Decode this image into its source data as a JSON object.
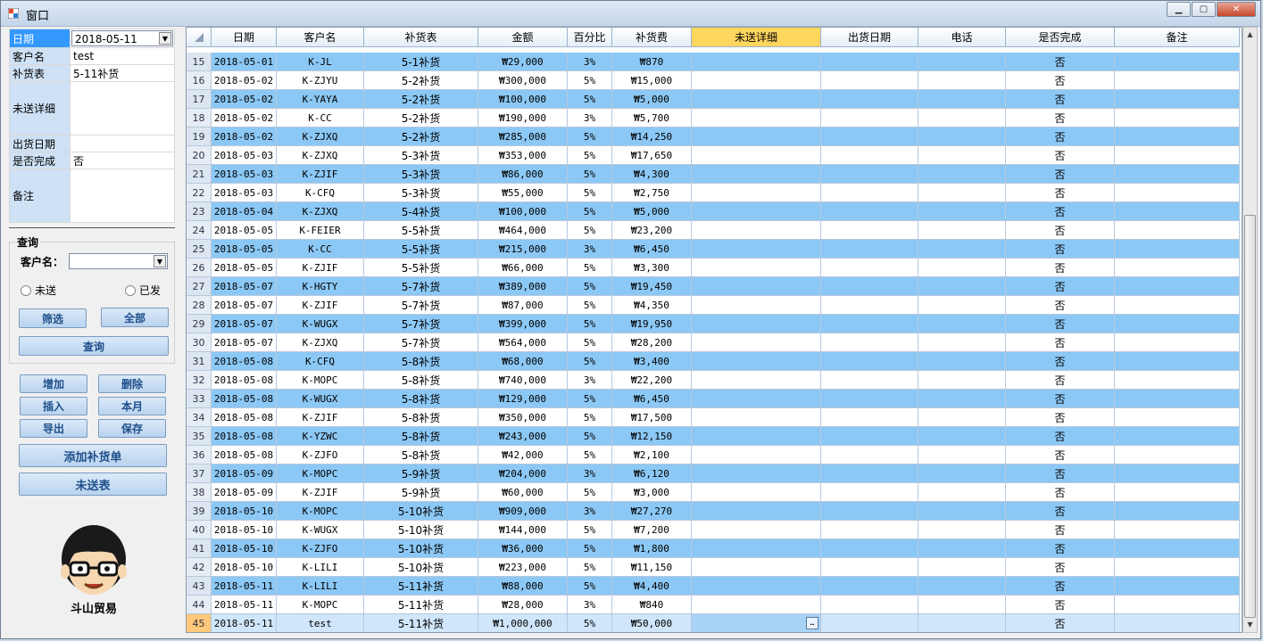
{
  "window": {
    "title": "窗口",
    "controls": {
      "minimize": "▁",
      "maximize": "▢",
      "close": "✕"
    }
  },
  "form": {
    "fields": [
      {
        "label": "日期",
        "value": "2018-05-11",
        "selected": true
      },
      {
        "label": "客户名",
        "value": "test"
      },
      {
        "label": "补货表",
        "value": "5-11补货"
      },
      {
        "label": "未送详细",
        "value": ""
      },
      {
        "label": "出货日期",
        "value": ""
      },
      {
        "label": "是否完成",
        "value": "否"
      },
      {
        "label": "备注",
        "value": ""
      }
    ]
  },
  "query": {
    "legend": "查询",
    "customer_label": "客户名：",
    "customer_value": "",
    "radio_unsent": "未送",
    "radio_sent": "已发",
    "filter_button": "筛选",
    "all_button": "全部",
    "query_button": "查询"
  },
  "actions": {
    "add": "增加",
    "delete": "删除",
    "insert": "插入",
    "this_month": "本月",
    "export": "导出",
    "save": "保存",
    "add_order": "添加补货单",
    "unsent_table": "未送表"
  },
  "logo": {
    "name": "斗山贸易"
  },
  "grid": {
    "columns": [
      "日期",
      "客户名",
      "补货表",
      "金额",
      "百分比",
      "补货费",
      "未送详细",
      "出货日期",
      "电话",
      "是否完成",
      "备注"
    ],
    "active_column": 6,
    "current_row": 45,
    "rows": [
      {
        "n": "15",
        "date": "2018-05-01",
        "cust": "K-JL",
        "table": "5-1补货",
        "amount": "₩29,000",
        "pct": "3%",
        "fee": "₩870",
        "done": "否"
      },
      {
        "n": "16",
        "date": "2018-05-02",
        "cust": "K-ZJYU",
        "table": "5-2补货",
        "amount": "₩300,000",
        "pct": "5%",
        "fee": "₩15,000",
        "done": "否"
      },
      {
        "n": "17",
        "date": "2018-05-02",
        "cust": "K-YAYA",
        "table": "5-2补货",
        "amount": "₩100,000",
        "pct": "5%",
        "fee": "₩5,000",
        "done": "否"
      },
      {
        "n": "18",
        "date": "2018-05-02",
        "cust": "K-CC",
        "table": "5-2补货",
        "amount": "₩190,000",
        "pct": "3%",
        "fee": "₩5,700",
        "done": "否"
      },
      {
        "n": "19",
        "date": "2018-05-02",
        "cust": "K-ZJXQ",
        "table": "5-2补货",
        "amount": "₩285,000",
        "pct": "5%",
        "fee": "₩14,250",
        "done": "否"
      },
      {
        "n": "20",
        "date": "2018-05-03",
        "cust": "K-ZJXQ",
        "table": "5-3补货",
        "amount": "₩353,000",
        "pct": "5%",
        "fee": "₩17,650",
        "done": "否"
      },
      {
        "n": "21",
        "date": "2018-05-03",
        "cust": "K-ZJIF",
        "table": "5-3补货",
        "amount": "₩86,000",
        "pct": "5%",
        "fee": "₩4,300",
        "done": "否"
      },
      {
        "n": "22",
        "date": "2018-05-03",
        "cust": "K-CFQ",
        "table": "5-3补货",
        "amount": "₩55,000",
        "pct": "5%",
        "fee": "₩2,750",
        "done": "否"
      },
      {
        "n": "23",
        "date": "2018-05-04",
        "cust": "K-ZJXQ",
        "table": "5-4补货",
        "amount": "₩100,000",
        "pct": "5%",
        "fee": "₩5,000",
        "done": "否"
      },
      {
        "n": "24",
        "date": "2018-05-05",
        "cust": "K-FEIER",
        "table": "5-5补货",
        "amount": "₩464,000",
        "pct": "5%",
        "fee": "₩23,200",
        "done": "否"
      },
      {
        "n": "25",
        "date": "2018-05-05",
        "cust": "K-CC",
        "table": "5-5补货",
        "amount": "₩215,000",
        "pct": "3%",
        "fee": "₩6,450",
        "done": "否"
      },
      {
        "n": "26",
        "date": "2018-05-05",
        "cust": "K-ZJIF",
        "table": "5-5补货",
        "amount": "₩66,000",
        "pct": "5%",
        "fee": "₩3,300",
        "done": "否"
      },
      {
        "n": "27",
        "date": "2018-05-07",
        "cust": "K-HGTY",
        "table": "5-7补货",
        "amount": "₩389,000",
        "pct": "5%",
        "fee": "₩19,450",
        "done": "否"
      },
      {
        "n": "28",
        "date": "2018-05-07",
        "cust": "K-ZJIF",
        "table": "5-7补货",
        "amount": "₩87,000",
        "pct": "5%",
        "fee": "₩4,350",
        "done": "否"
      },
      {
        "n": "29",
        "date": "2018-05-07",
        "cust": "K-WUGX",
        "table": "5-7补货",
        "amount": "₩399,000",
        "pct": "5%",
        "fee": "₩19,950",
        "done": "否"
      },
      {
        "n": "30",
        "date": "2018-05-07",
        "cust": "K-ZJXQ",
        "table": "5-7补货",
        "amount": "₩564,000",
        "pct": "5%",
        "fee": "₩28,200",
        "done": "否"
      },
      {
        "n": "31",
        "date": "2018-05-08",
        "cust": "K-CFQ",
        "table": "5-8补货",
        "amount": "₩68,000",
        "pct": "5%",
        "fee": "₩3,400",
        "done": "否"
      },
      {
        "n": "32",
        "date": "2018-05-08",
        "cust": "K-MOPC",
        "table": "5-8补货",
        "amount": "₩740,000",
        "pct": "3%",
        "fee": "₩22,200",
        "done": "否"
      },
      {
        "n": "33",
        "date": "2018-05-08",
        "cust": "K-WUGX",
        "table": "5-8补货",
        "amount": "₩129,000",
        "pct": "5%",
        "fee": "₩6,450",
        "done": "否"
      },
      {
        "n": "34",
        "date": "2018-05-08",
        "cust": "K-ZJIF",
        "table": "5-8补货",
        "amount": "₩350,000",
        "pct": "5%",
        "fee": "₩17,500",
        "done": "否"
      },
      {
        "n": "35",
        "date": "2018-05-08",
        "cust": "K-YZWC",
        "table": "5-8补货",
        "amount": "₩243,000",
        "pct": "5%",
        "fee": "₩12,150",
        "done": "否"
      },
      {
        "n": "36",
        "date": "2018-05-08",
        "cust": "K-ZJFO",
        "table": "5-8补货",
        "amount": "₩42,000",
        "pct": "5%",
        "fee": "₩2,100",
        "done": "否"
      },
      {
        "n": "37",
        "date": "2018-05-09",
        "cust": "K-MOPC",
        "table": "5-9补货",
        "amount": "₩204,000",
        "pct": "3%",
        "fee": "₩6,120",
        "done": "否"
      },
      {
        "n": "38",
        "date": "2018-05-09",
        "cust": "K-ZJIF",
        "table": "5-9补货",
        "amount": "₩60,000",
        "pct": "5%",
        "fee": "₩3,000",
        "done": "否"
      },
      {
        "n": "39",
        "date": "2018-05-10",
        "cust": "K-MOPC",
        "table": "5-10补货",
        "amount": "₩909,000",
        "pct": "3%",
        "fee": "₩27,270",
        "done": "否"
      },
      {
        "n": "40",
        "date": "2018-05-10",
        "cust": "K-WUGX",
        "table": "5-10补货",
        "amount": "₩144,000",
        "pct": "5%",
        "fee": "₩7,200",
        "done": "否"
      },
      {
        "n": "41",
        "date": "2018-05-10",
        "cust": "K-ZJFO",
        "table": "5-10补货",
        "amount": "₩36,000",
        "pct": "5%",
        "fee": "₩1,800",
        "done": "否"
      },
      {
        "n": "42",
        "date": "2018-05-10",
        "cust": "K-LILI",
        "table": "5-10补货",
        "amount": "₩223,000",
        "pct": "5%",
        "fee": "₩11,150",
        "done": "否"
      },
      {
        "n": "43",
        "date": "2018-05-11",
        "cust": "K-LILI",
        "table": "5-11补货",
        "amount": "₩88,000",
        "pct": "5%",
        "fee": "₩4,400",
        "done": "否"
      },
      {
        "n": "44",
        "date": "2018-05-11",
        "cust": "K-MOPC",
        "table": "5-11补货",
        "amount": "₩28,000",
        "pct": "3%",
        "fee": "₩840",
        "done": "否"
      },
      {
        "n": "45",
        "date": "2018-05-11",
        "cust": "test",
        "table": "5-11补货",
        "amount": "₩1,000,000",
        "pct": "5%",
        "fee": "₩50,000",
        "done": "否"
      }
    ]
  }
}
